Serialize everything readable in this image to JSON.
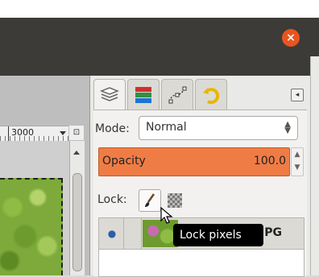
{
  "window": {
    "close_glyph": "×"
  },
  "canvas": {
    "ruler_label": "3000"
  },
  "dock": {
    "tabs": [
      {
        "icon": "layers-icon"
      },
      {
        "icon": "channels-icon"
      },
      {
        "icon": "paths-icon"
      },
      {
        "icon": "undo-history-icon"
      }
    ],
    "mode_label": "Mode:",
    "mode_value": "Normal",
    "opacity_label": "Opacity",
    "opacity_value": "100.0",
    "lock_label": "Lock:",
    "layer": {
      "name": "JPG"
    },
    "tooltip": "Lock pixels",
    "colors": {
      "accent": "#ef7c45",
      "titlebar": "#3c3b37",
      "close": "#e95420"
    }
  }
}
